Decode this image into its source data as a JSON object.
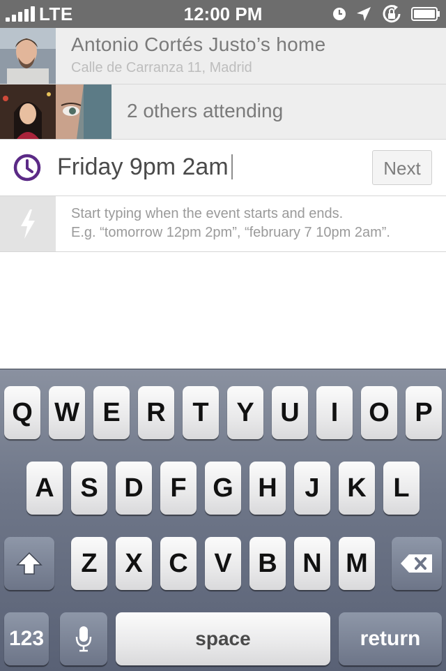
{
  "status_bar": {
    "carrier": "LTE",
    "time": "12:00 PM"
  },
  "host": {
    "name": "Antonio Cortés Justo’s home",
    "address": "Calle de Carranza 11, Madrid"
  },
  "attendees": {
    "summary": "2 others attending"
  },
  "time_input": {
    "value": "Friday 9pm 2am",
    "next_label": "Next"
  },
  "hint": {
    "line1": "Start typing when the event starts and ends.",
    "line2": "E.g. “tomorrow 12pm 2pm”, “february 7 10pm 2am”."
  },
  "colors": {
    "accent": "#5b2a86",
    "status_bar": "#6d6d6d",
    "row_bg": "#eeeeee"
  },
  "keyboard": {
    "row1": [
      "Q",
      "W",
      "E",
      "R",
      "T",
      "Y",
      "U",
      "I",
      "O",
      "P"
    ],
    "row2": [
      "A",
      "S",
      "D",
      "F",
      "G",
      "H",
      "J",
      "K",
      "L"
    ],
    "row3": [
      "Z",
      "X",
      "C",
      "V",
      "B",
      "N",
      "M"
    ],
    "numbers_label": "123",
    "space_label": "space",
    "return_label": "return",
    "shift_icon": "shift-icon",
    "delete_icon": "delete-icon",
    "mic_icon": "microphone-icon"
  }
}
